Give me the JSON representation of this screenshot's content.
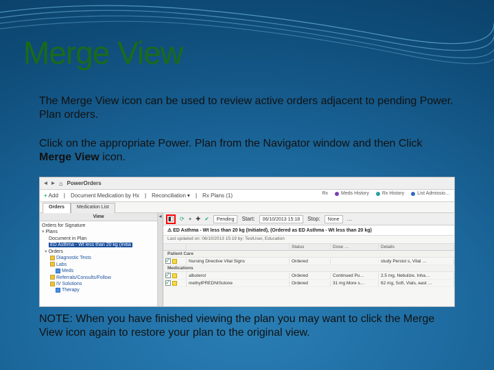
{
  "title": "Merge View",
  "p1": "The Merge View icon can be used to review active orders adjacent to pending Power. Plan orders.",
  "p2a": "Click on the appropriate Power. Plan from the Navigator window and then Click ",
  "p2b": "Merge View",
  "p2c": " icon.",
  "p3": "NOTE:  When you have finished viewing the plan you may want to click the Merge View icon  again to restore your plan to the original view.",
  "app": {
    "crumb": "PowerOrders",
    "topright": {
      "rx": "Rx",
      "m1": "Meds History",
      "m2": "Rx History",
      "m3": "List Admissio…"
    },
    "actions": {
      "add": "Add",
      "doc": "Document Medication by Hx",
      "recon": "Reconciliation",
      "rx": "Rx Plans (1)"
    },
    "tabs": {
      "orders": "Orders",
      "medlist": "Medication List"
    },
    "nav": {
      "head": "View",
      "items": [
        "Orders for Signature",
        "Plans",
        "Document in Plan"
      ],
      "selected": "ED Asthma - Wt less than 20 kg (Initia",
      "subs": [
        "Diagnostic Tests",
        "Labs",
        "Meds",
        "Referrals/Consults/Follow",
        "IV Solutions",
        "Therapy"
      ]
    },
    "maintop": {
      "pending": "Pending",
      "start": "Start:",
      "date": "06/10/2013 15:18",
      "stop": "Stop:",
      "none": "None"
    },
    "plan_title": "ED Asthma - Wt less than 20 kg (Initiated), (Ordered as ED Asthma - Wt less than 20 kg)",
    "plan_sub": "Last updated on: 06/10/2013 15:19  by: TestUser, Education",
    "grid_head": {
      "name": "",
      "status": "Status",
      "dose": "Dose …",
      "details": "Details"
    },
    "sections": {
      "pcare": "Patient Care",
      "meds": "Medications"
    },
    "rows": [
      {
        "name": "Nursing Directive Vital Signs",
        "status": "Ordered",
        "dose": "",
        "det": "study Persist s, Vital …"
      },
      {
        "name": "albuterol",
        "status": "Ordered",
        "dose": "Continued Pu…",
        "det": "2.5 mg, Nebulize, Inha…"
      },
      {
        "name": "methylPREDNISolone",
        "status": "Ordered",
        "dose": "31 mg More s…",
        "det": "62 mg, Soft, Vials, east …"
      }
    ]
  }
}
